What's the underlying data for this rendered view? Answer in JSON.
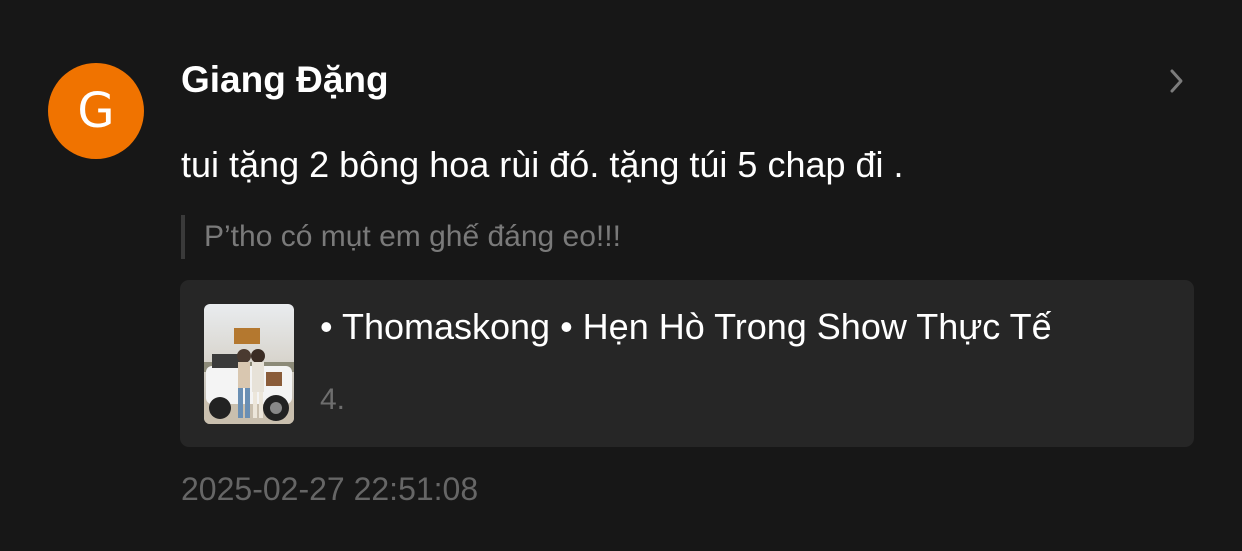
{
  "comment": {
    "avatar": {
      "initial": "G",
      "color": "#f07300"
    },
    "username": "Giang Đặng",
    "chevron_icon": "chevron-right-icon",
    "text": "tui tặng 2 bông hoa rùi đó. tặng túi 5 chap đi .",
    "quote": "P’tho có mụt em ghế đáng eo!!!",
    "work_card": {
      "title": "• Thomaskong • Hẹn Hò Trong Show Thực Tế",
      "subtitle": "4.",
      "thumbnail_icon": "cover-image"
    },
    "timestamp": "2025-02-27 22:51:08"
  }
}
